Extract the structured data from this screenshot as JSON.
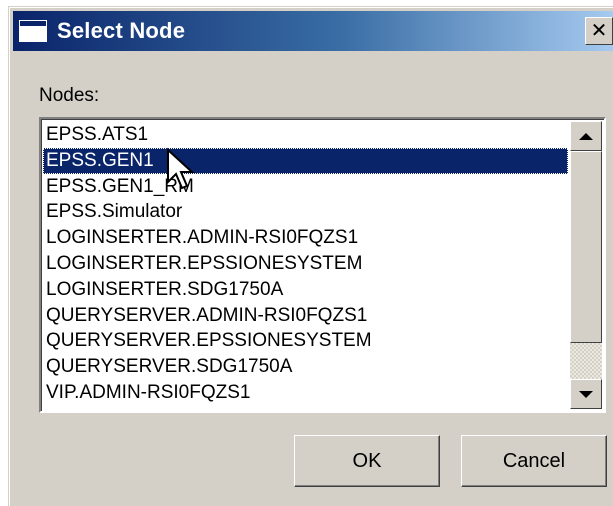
{
  "window": {
    "title": "Select Node",
    "close_label": "✕"
  },
  "nodes": {
    "label": "Nodes:",
    "items": [
      "EPSS.ATS1",
      "EPSS.GEN1",
      "EPSS.GEN1_RM",
      "EPSS.Simulator",
      "LOGINSERTER.ADMIN-RSI0FQZS1",
      "LOGINSERTER.EPSSIONESYSTEM",
      "LOGINSERTER.SDG1750A",
      "QUERYSERVER.ADMIN-RSI0FQZS1",
      "QUERYSERVER.EPSSIONESYSTEM",
      "QUERYSERVER.SDG1750A",
      "VIP.ADMIN-RSI0FQZS1"
    ],
    "selected_index": 1
  },
  "buttons": {
    "ok_label": "OK",
    "cancel_label": "Cancel"
  },
  "colors": {
    "title_bar": "#0a246a",
    "selection": "#0a246a",
    "dialog_face": "#d4d0c8"
  },
  "icons": {
    "title": "window-icon",
    "close": "close-icon",
    "scroll_up": "arrow-up-icon",
    "scroll_down": "arrow-down-icon",
    "pointer": "mouse-pointer-icon"
  }
}
